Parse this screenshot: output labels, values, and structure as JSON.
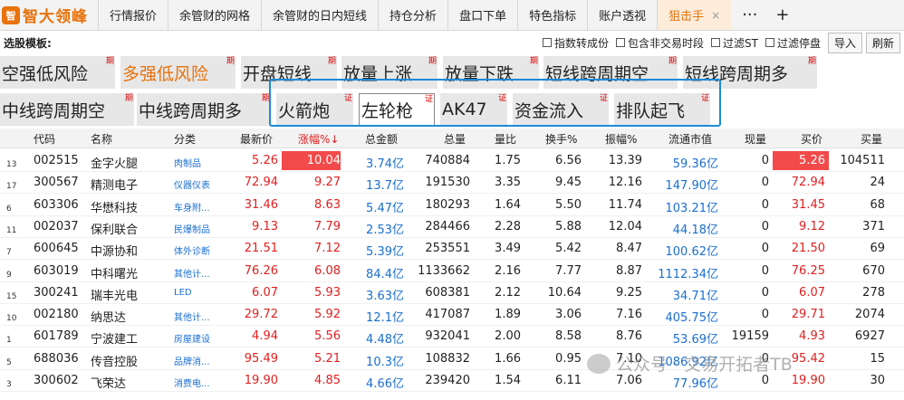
{
  "app": {
    "logo_text": "智大领峰",
    "logo_mark": "智"
  },
  "tabs": [
    {
      "label": "行情报价"
    },
    {
      "label": "余管财的网格"
    },
    {
      "label": "余管财的日内短线"
    },
    {
      "label": "持仓分析"
    },
    {
      "label": "盘口下单"
    },
    {
      "label": "特色指标"
    },
    {
      "label": "账户透视"
    },
    {
      "label": "狙击手",
      "active": true,
      "close": "×"
    }
  ],
  "tab_tools": {
    "more": "···",
    "add": "+"
  },
  "toolbar": {
    "title": "选股模板:",
    "checkboxes": [
      "指数转成份",
      "包含非交易时段",
      "过滤ST",
      "过滤停盘"
    ],
    "import_label": "导入",
    "refresh_label": "刷新"
  },
  "templates_row1": [
    {
      "label": "空强低风险",
      "tag": "期"
    },
    {
      "label": "多强低风险",
      "tag": "期"
    },
    {
      "label": "开盘短线",
      "tag": "期"
    },
    {
      "label": "放量上涨",
      "tag": "期"
    },
    {
      "label": "放量下跌",
      "tag": "期"
    },
    {
      "label": "短线跨周期空",
      "tag": "期"
    },
    {
      "label": "短线跨周期多",
      "tag": "期"
    }
  ],
  "templates_row2": [
    {
      "label": "中线跨周期空",
      "tag": "期"
    },
    {
      "label": "中线跨周期多",
      "tag": "期"
    },
    {
      "label": "火箭炮",
      "tag": "证"
    },
    {
      "label": "左轮枪",
      "tag": "证"
    },
    {
      "label": "AK47",
      "tag": "证"
    },
    {
      "label": "资金流入",
      "tag": "证"
    },
    {
      "label": "排队起飞",
      "tag": "证"
    }
  ],
  "table": {
    "headers": [
      "代码",
      "名称",
      "分类",
      "最新价",
      "涨幅%↓",
      "总金额",
      "总量",
      "量比",
      "换手%",
      "振幅%",
      "流通市值",
      "现量",
      "买价",
      "买量"
    ],
    "rows": [
      {
        "idx": "13",
        "code": "002515",
        "name": "金字火腿",
        "cat": "肉制品",
        "price": "5.26",
        "chg": "10.04",
        "amt": "3.74亿",
        "vol": "740884",
        "vr": "1.75",
        "turn": "6.56",
        "amp": "13.39",
        "mcap": "59.36亿",
        "cur": "0",
        "bid": "5.26",
        "bidvol": "104511"
      },
      {
        "idx": "17",
        "code": "300567",
        "name": "精测电子",
        "cat": "仪器仪表",
        "price": "72.94",
        "chg": "9.27",
        "amt": "13.7亿",
        "vol": "191530",
        "vr": "3.35",
        "turn": "9.45",
        "amp": "12.16",
        "mcap": "147.90亿",
        "cur": "0",
        "bid": "72.94",
        "bidvol": "24"
      },
      {
        "idx": "6",
        "code": "603306",
        "name": "华懋科技",
        "cat": "车身附...",
        "price": "31.46",
        "chg": "8.63",
        "amt": "5.47亿",
        "vol": "180293",
        "vr": "1.64",
        "turn": "5.50",
        "amp": "11.74",
        "mcap": "103.21亿",
        "cur": "0",
        "bid": "31.45",
        "bidvol": "68"
      },
      {
        "idx": "11",
        "code": "002037",
        "name": "保利联合",
        "cat": "民爆制品",
        "price": "9.13",
        "chg": "7.79",
        "amt": "2.53亿",
        "vol": "284466",
        "vr": "2.28",
        "turn": "5.88",
        "amp": "12.04",
        "mcap": "44.18亿",
        "cur": "0",
        "bid": "9.12",
        "bidvol": "371"
      },
      {
        "idx": "7",
        "code": "600645",
        "name": "中源协和",
        "cat": "体外诊断",
        "price": "21.51",
        "chg": "7.12",
        "amt": "5.39亿",
        "vol": "253551",
        "vr": "3.49",
        "turn": "5.42",
        "amp": "8.47",
        "mcap": "100.62亿",
        "cur": "0",
        "bid": "21.50",
        "bidvol": "69"
      },
      {
        "idx": "9",
        "code": "603019",
        "name": "中科曙光",
        "cat": "其他计...",
        "price": "76.26",
        "chg": "6.08",
        "amt": "84.4亿",
        "vol": "1133662",
        "vr": "2.16",
        "turn": "7.77",
        "amp": "8.87",
        "mcap": "1112.34亿",
        "cur": "0",
        "bid": "76.25",
        "bidvol": "670"
      },
      {
        "idx": "15",
        "code": "300241",
        "name": "瑞丰光电",
        "cat": "LED",
        "price": "6.07",
        "chg": "5.93",
        "amt": "3.63亿",
        "vol": "608381",
        "vr": "2.12",
        "turn": "10.64",
        "amp": "9.25",
        "mcap": "34.71亿",
        "cur": "0",
        "bid": "6.07",
        "bidvol": "278"
      },
      {
        "idx": "10",
        "code": "002180",
        "name": "纳思达",
        "cat": "其他计...",
        "price": "29.72",
        "chg": "5.92",
        "amt": "12.1亿",
        "vol": "417087",
        "vr": "1.89",
        "turn": "3.06",
        "amp": "7.16",
        "mcap": "405.75亿",
        "cur": "0",
        "bid": "29.71",
        "bidvol": "2074"
      },
      {
        "idx": "1",
        "code": "601789",
        "name": "宁波建工",
        "cat": "房屋建设",
        "price": "4.94",
        "chg": "5.56",
        "amt": "4.48亿",
        "vol": "932041",
        "vr": "2.00",
        "turn": "8.58",
        "amp": "8.76",
        "mcap": "53.69亿",
        "cur": "19159",
        "bid": "4.93",
        "bidvol": "6927"
      },
      {
        "idx": "5",
        "code": "688036",
        "name": "传音控股",
        "cat": "品牌消...",
        "price": "95.49",
        "chg": "5.21",
        "amt": "10.3亿",
        "vol": "108832",
        "vr": "1.66",
        "turn": "0.95",
        "amp": "7.10",
        "mcap": "1086.92亿",
        "cur": "0",
        "bid": "95.42",
        "bidvol": "15"
      },
      {
        "idx": "3",
        "code": "300602",
        "name": "飞荣达",
        "cat": "消费电...",
        "price": "19.90",
        "chg": "4.85",
        "amt": "4.66亿",
        "vol": "239420",
        "vr": "1.54",
        "turn": "6.11",
        "amp": "7.06",
        "mcap": "77.96亿",
        "cur": "0",
        "bid": "19.90",
        "bidvol": "30"
      }
    ]
  },
  "watermark": "公众号 · 交易开拓者TB",
  "colors": {
    "accent": "#e8720c",
    "up_red": "#e02020",
    "link_blue": "#1a6fd0",
    "frame_blue": "#1c8bd6"
  }
}
